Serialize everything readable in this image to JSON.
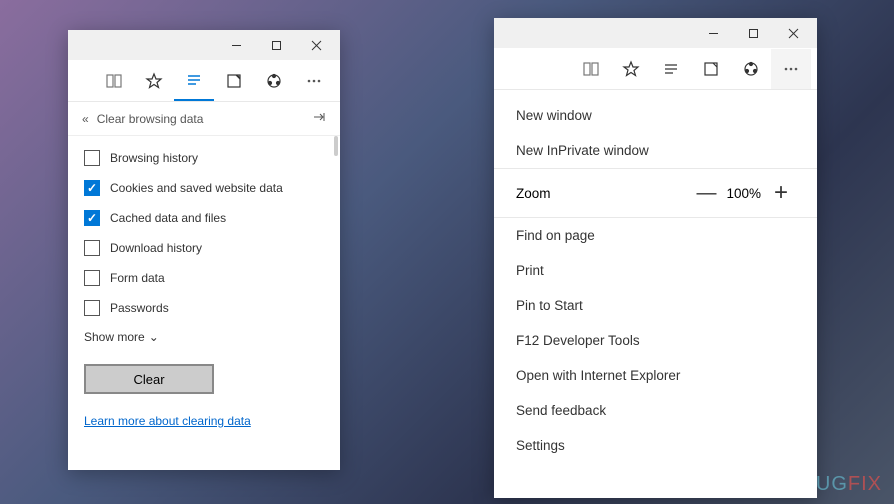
{
  "watermark": {
    "part1": "UG",
    "part2": "FIX"
  },
  "left_window": {
    "panel_title": "Clear browsing data",
    "items": [
      {
        "label": "Browsing history",
        "checked": false
      },
      {
        "label": "Cookies and saved website data",
        "checked": true
      },
      {
        "label": "Cached data and files",
        "checked": true
      },
      {
        "label": "Download history",
        "checked": false
      },
      {
        "label": "Form data",
        "checked": false
      },
      {
        "label": "Passwords",
        "checked": false
      }
    ],
    "show_more": "Show more",
    "clear_button": "Clear",
    "learn_more": "Learn more about clearing data"
  },
  "right_window": {
    "menu": {
      "new_window": "New window",
      "new_inprivate": "New InPrivate window",
      "zoom_label": "Zoom",
      "zoom_value": "100%",
      "find": "Find on page",
      "print": "Print",
      "pin": "Pin to Start",
      "devtools": "F12 Developer Tools",
      "open_ie": "Open with Internet Explorer",
      "feedback": "Send feedback",
      "settings": "Settings"
    }
  }
}
